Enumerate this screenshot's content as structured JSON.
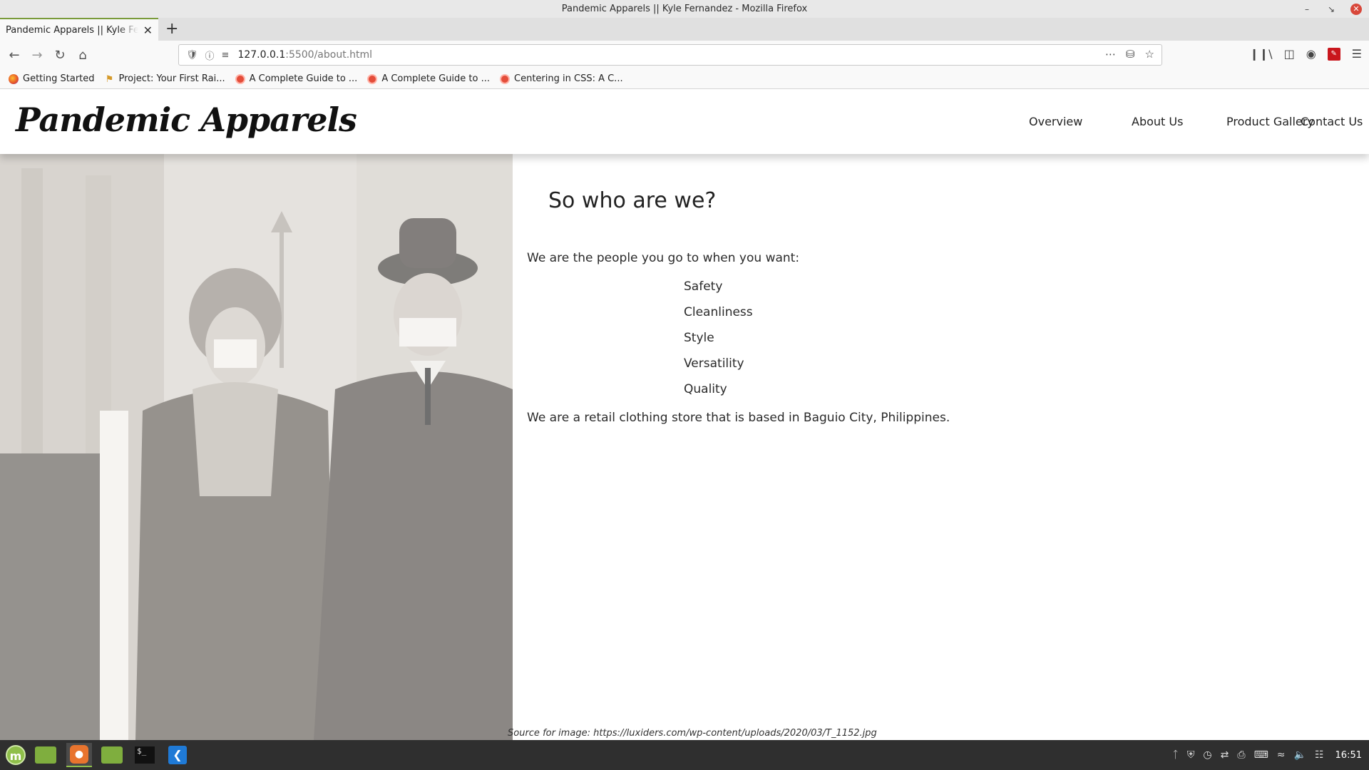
{
  "window": {
    "title": "Pandemic Apparels || Kyle Fernandez - Mozilla Firefox"
  },
  "tabs": [
    {
      "label": "Pandemic Apparels || Kyle Fernandez",
      "active": true
    }
  ],
  "navbar": {
    "url_host": "127.0.0.1",
    "url_path": ":5500/about.html"
  },
  "bookmarks": [
    {
      "label": "Getting Started",
      "icon": "firefox-icon"
    },
    {
      "label": "Project: Your First Rai...",
      "icon": "rails-icon"
    },
    {
      "label": "A Complete Guide to ...",
      "icon": "css-tricks-icon"
    },
    {
      "label": "A Complete Guide to ...",
      "icon": "css-tricks-icon"
    },
    {
      "label": "Centering in CSS: A C...",
      "icon": "css-tricks-icon"
    }
  ],
  "site": {
    "logo": "Pandemic Apparels",
    "nav": [
      "Overview",
      "About Us",
      "Product Gallery",
      "Contact Us"
    ],
    "heading": "So who are we?",
    "intro": "We are the people you go to when you want:",
    "qualities": [
      "Safety",
      "Cleanliness",
      "Style",
      "Versatility",
      "Quality"
    ],
    "outro": "We are a retail clothing store that is based in Baguio City, Philippines.",
    "image_source": "Source for image: https://luxiders.com/wp-content/uploads/2020/03/T_1152.jpg"
  },
  "taskbar": {
    "clock": "16:51"
  },
  "colors": {
    "tab_accent": "#7a9b3b",
    "taskbar_bg": "#2f2f2f",
    "mint_green": "#8fbf4a"
  }
}
